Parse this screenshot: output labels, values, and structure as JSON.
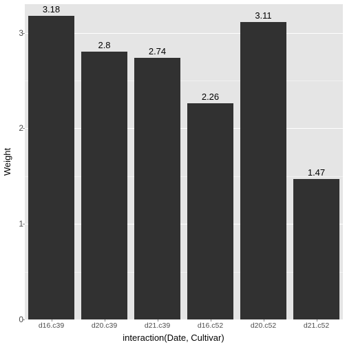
{
  "chart_data": {
    "type": "bar",
    "categories": [
      "d16.c39",
      "d20.c39",
      "d21.c39",
      "d16.c52",
      "d20.c52",
      "d21.c52"
    ],
    "values": [
      3.18,
      2.8,
      2.74,
      2.26,
      3.11,
      1.47
    ],
    "title": "",
    "xlabel": "interaction(Date, Cultivar)",
    "ylabel": "Weight",
    "ylim": [
      0,
      3.3
    ],
    "yticks": [
      0,
      1,
      2,
      3
    ]
  }
}
